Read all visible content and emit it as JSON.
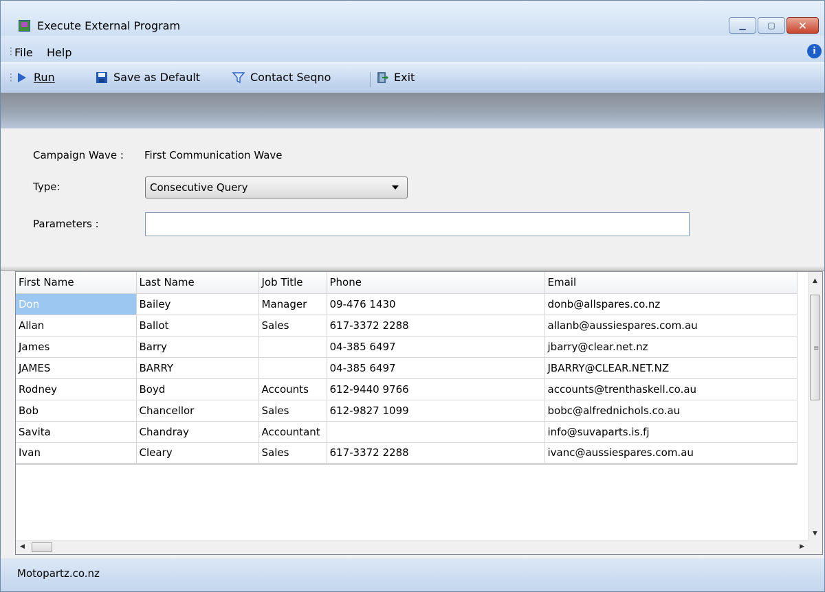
{
  "window": {
    "title": "Execute External Program",
    "icon": "app-window-icon"
  },
  "menu": {
    "items": [
      "File",
      "Help"
    ],
    "info_icon": "info-icon"
  },
  "toolbar": {
    "run": "Run",
    "save_default": "Save as Default",
    "contact_seqno": "Contact Seqno",
    "exit": "Exit"
  },
  "form": {
    "campaign_wave_label": "Campaign Wave :",
    "campaign_wave_value": "First Communication Wave",
    "type_label": "Type:",
    "type_value": "Consecutive Query",
    "parameters_label": "Parameters :",
    "parameters_value": ""
  },
  "grid": {
    "columns": [
      "First Name",
      "Last Name",
      "Job Title",
      "Phone",
      "Email"
    ],
    "selected_row": 0,
    "rows": [
      [
        "Don",
        "Bailey",
        "Manager",
        "09-476 1430",
        "donb@allspares.co.nz"
      ],
      [
        "Allan",
        "Ballot",
        "Sales",
        "617-3372 2288",
        "allanb@aussiespares.com.au"
      ],
      [
        "James",
        "Barry",
        "",
        "04-385 6497",
        "jbarry@clear.net.nz"
      ],
      [
        "JAMES",
        "BARRY",
        "",
        "04-385 6497",
        "JBARRY@CLEAR.NET.NZ"
      ],
      [
        "Rodney",
        "Boyd",
        "Accounts",
        "612-9440 9766",
        "accounts@trenthaskell.co.au"
      ],
      [
        "Bob",
        "Chancellor",
        "Sales",
        "612-9827 1099",
        "bobc@alfrednichols.co.au"
      ],
      [
        "Savita",
        "Chandray",
        "Accountant",
        "",
        "info@suvaparts.is.fj"
      ],
      [
        "Ivan",
        "Cleary",
        "Sales",
        "617-3372 2288",
        "ivanc@aussiespares.com.au"
      ]
    ]
  },
  "status": {
    "text": "Motopartz.co.nz"
  },
  "colors": {
    "selection": "#9bc7f0",
    "titlebar": "#d8e6f6",
    "close_button": "#c8442c"
  }
}
